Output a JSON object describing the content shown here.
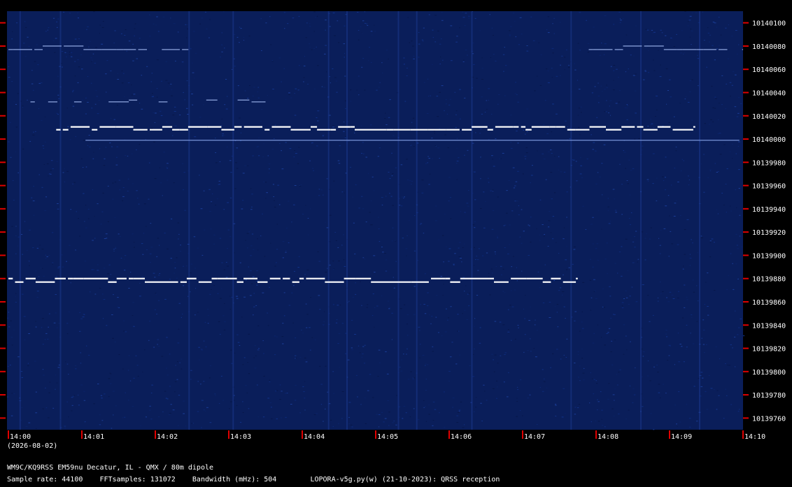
{
  "chart_data": {
    "type": "heatmap",
    "subtype": "QRSS waterfall spectrogram",
    "y_axis": {
      "unit": "Hz",
      "min": 10139750,
      "max": 10140110,
      "tick_labels": [
        "10140100",
        "10140080",
        "10140060",
        "10140040",
        "10140020",
        "10140000",
        "10139980",
        "10139960",
        "10139940",
        "10139920",
        "10139900",
        "10139880",
        "10139860",
        "10139840",
        "10139820",
        "10139800",
        "10139780",
        "10139760"
      ],
      "tick_values": [
        10140100,
        10140080,
        10140060,
        10140040,
        10140020,
        10140000,
        10139980,
        10139960,
        10139940,
        10139920,
        10139900,
        10139880,
        10139860,
        10139840,
        10139820,
        10139800,
        10139780,
        10139760
      ]
    },
    "x_axis": {
      "unit": "minutes",
      "min": 0,
      "max": 10,
      "tick_labels": [
        "14:00",
        "14:01",
        "14:02",
        "14:03",
        "14:04",
        "14:05",
        "14:06",
        "14:07",
        "14:08",
        "14:09",
        "14:10"
      ],
      "tick_values": [
        0,
        1,
        2,
        3,
        4,
        5,
        6,
        7,
        8,
        9,
        10
      ],
      "date_label": "(2026-08-02)"
    },
    "background_color": "#0a1e5a",
    "signal_color": "#ffffff",
    "tick_color": "#e00000",
    "signals": [
      {
        "freq": 10140008,
        "t_start": 0.65,
        "t_end": 9.35,
        "shift_hz": 2.5,
        "style": "morse-fsk"
      },
      {
        "freq": 10139999,
        "t_start": 1.05,
        "t_end": 9.95,
        "shift_hz": 0,
        "style": "carrier"
      },
      {
        "freq": 10139877,
        "t_start": 0.0,
        "t_end": 7.75,
        "shift_hz": 3,
        "style": "morse-fsk"
      },
      {
        "freq": 10140077,
        "t_start": 0.0,
        "t_end": 2.45,
        "shift_hz": 3,
        "style": "faint-fsk"
      },
      {
        "freq": 10140077,
        "t_start": 7.9,
        "t_end": 10.0,
        "shift_hz": 3,
        "style": "faint-fsk"
      },
      {
        "freq": 10140032,
        "t_start": 0.3,
        "t_end": 3.5,
        "shift_hz": 1.5,
        "style": "faint-fsk"
      }
    ]
  },
  "footer": {
    "line1": "WM9C/KQ9RSS EM59nu Decatur, IL - QMX / 80m dipole",
    "line2": "Sample rate: 44100    FFTsamples: 131072    Bandwidth (mHz): 504        LOPORA-v5g.py(w) (21-10-2023): QRSS reception"
  }
}
